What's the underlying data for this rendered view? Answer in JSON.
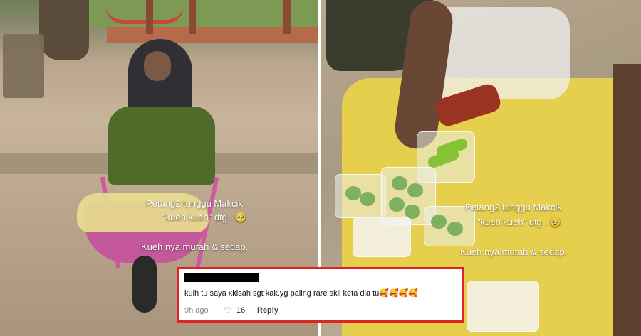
{
  "left_panel": {
    "caption_line1": "Petang2 tunggu Makcik",
    "caption_line2": "\"kueh kueh\" dtg . 🥹",
    "caption_line3": "Kueh nya murah & sedap."
  },
  "right_panel": {
    "caption_line1": "Petang2 tunggu Makcik",
    "caption_line2": "\"kueh kueh\" dtg . 🥹",
    "caption_line3": "Kueh nya murah & sedap."
  },
  "comment": {
    "text": "kuih tu saya xkisah sgt kak.yg paling rare skli keta dia tu🥰🥰🥰🥰",
    "time": "9h ago",
    "like_icon": "♡",
    "like_count": "16",
    "reply_label": "Reply",
    "highlight_color": "#e02424"
  }
}
